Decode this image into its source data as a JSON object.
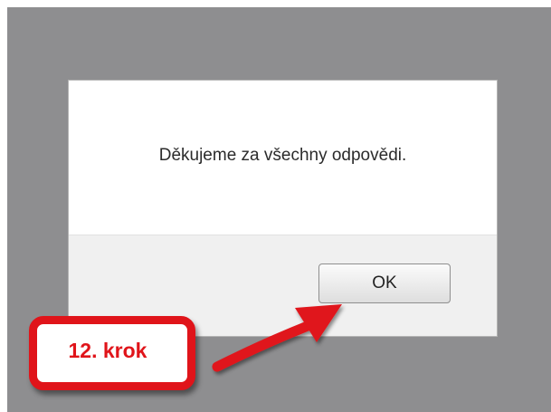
{
  "dialog": {
    "message": "Děkujeme za všechny odpovědi.",
    "ok_label": "OK"
  },
  "annotation": {
    "step_label": "12. krok",
    "accent_color": "#e0141a"
  }
}
